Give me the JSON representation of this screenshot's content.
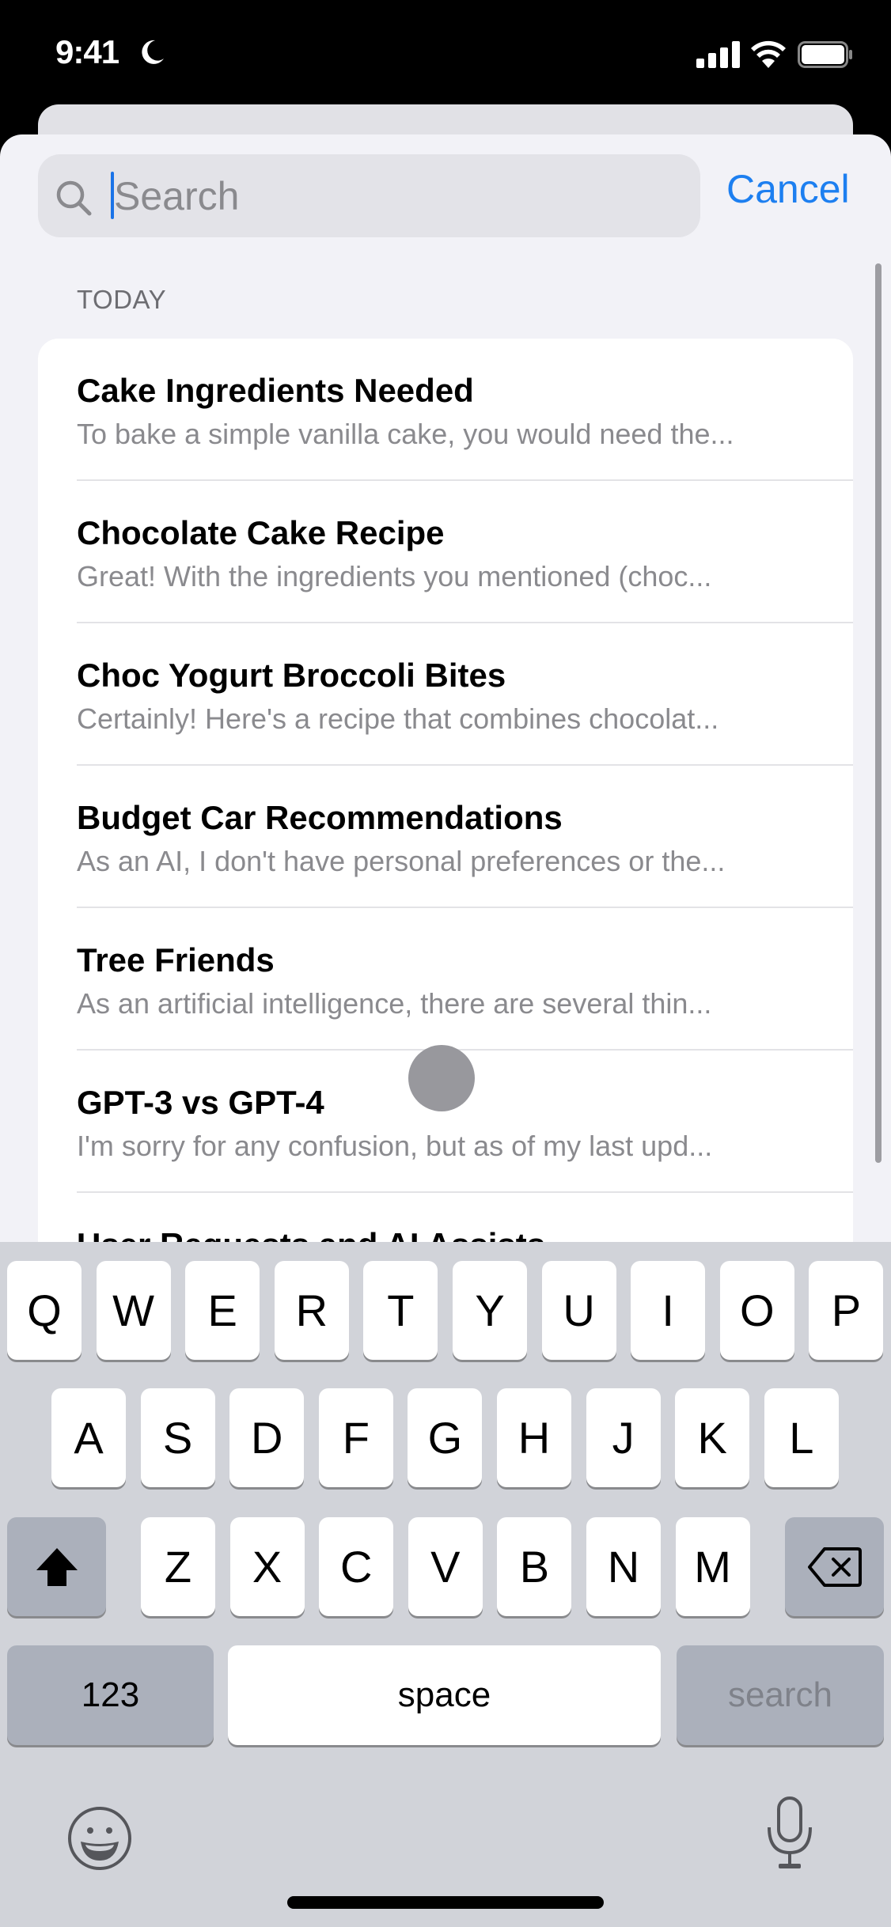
{
  "status_bar": {
    "time": "9:41",
    "focus_icon": "moon-icon",
    "icons": [
      "cellular-signal-icon",
      "wifi-icon",
      "battery-icon"
    ]
  },
  "search": {
    "placeholder": "Search",
    "value": "",
    "cancel_label": "Cancel",
    "icon": "magnifying-glass-icon"
  },
  "section": {
    "header": "TODAY"
  },
  "conversations": [
    {
      "title": "Cake Ingredients Needed",
      "preview": "To bake a simple vanilla cake, you would need the..."
    },
    {
      "title": "Chocolate Cake Recipe",
      "preview": "Great! With the ingredients you mentioned (choc..."
    },
    {
      "title": "Choc Yogurt Broccoli Bites",
      "preview": "Certainly! Here's a recipe that combines chocolat..."
    },
    {
      "title": "Budget Car Recommendations",
      "preview": "As an AI, I don't have personal preferences or the..."
    },
    {
      "title": "Tree Friends",
      "preview": "As an artificial intelligence, there are several thin..."
    },
    {
      "title": "GPT-3 vs GPT-4",
      "preview": "I'm sorry for any confusion, but as of my last upd..."
    },
    {
      "title": "User Requests and AI Assists",
      "preview": ""
    }
  ],
  "keyboard": {
    "row1": [
      "Q",
      "W",
      "E",
      "R",
      "T",
      "Y",
      "U",
      "I",
      "O",
      "P"
    ],
    "row2": [
      "A",
      "S",
      "D",
      "F",
      "G",
      "H",
      "J",
      "K",
      "L"
    ],
    "row3": [
      "Z",
      "X",
      "C",
      "V",
      "B",
      "N",
      "M"
    ],
    "numbers_label": "123",
    "space_label": "space",
    "return_label": "search",
    "shift_icon": "shift-arrow-icon",
    "delete_icon": "delete-backspace-icon",
    "emoji_icon": "emoji-face-icon",
    "mic_icon": "microphone-icon"
  },
  "colors": {
    "accent": "#1d7ff0",
    "sheet_bg": "#f2f2f7",
    "keyboard_bg": "#d1d3d9"
  }
}
